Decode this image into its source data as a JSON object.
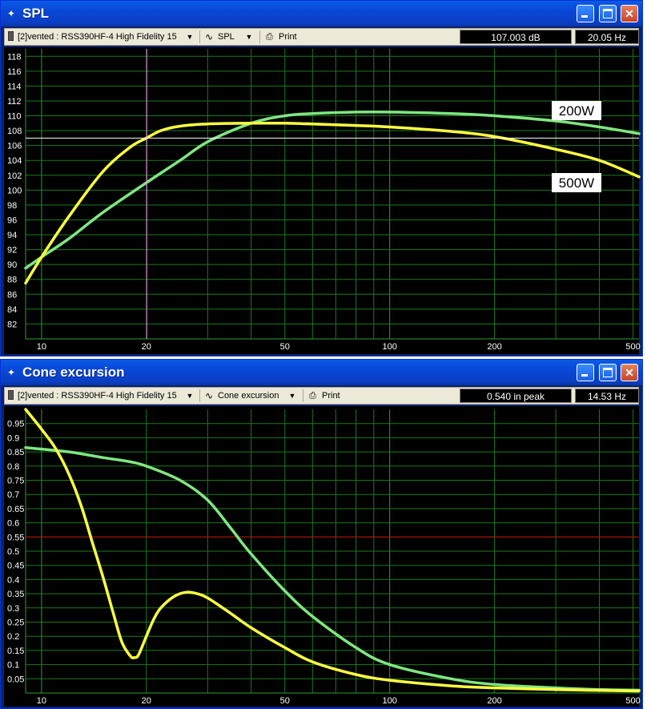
{
  "windows": [
    {
      "id": "spl",
      "title": "SPL",
      "driver_label": "[2]vented : RSS390HF-4 High Fidelity 15",
      "view_label": "SPL",
      "print_label": "Print",
      "readout_value": "107.003 dB",
      "readout_freq": "20.05 Hz"
    },
    {
      "id": "cone",
      "title": "Cone excursion",
      "driver_label": "[2]vented : RSS390HF-4 High Fidelity 15",
      "view_label": "Cone excursion",
      "print_label": "Print",
      "readout_value": "0.540 in peak",
      "readout_freq": "14.53 Hz"
    }
  ],
  "chart_data": [
    {
      "type": "line",
      "title": "SPL",
      "xscale": "log",
      "xlim": [
        9,
        520
      ],
      "ylim": [
        80,
        119
      ],
      "x_ticks": [
        10,
        20,
        50,
        100,
        200,
        500
      ],
      "y_ticks": [
        82,
        84,
        86,
        88,
        90,
        92,
        94,
        96,
        98,
        100,
        102,
        104,
        106,
        108,
        110,
        112,
        114,
        116,
        118
      ],
      "grid": true,
      "cursor": {
        "x": 20.05,
        "y": 107.003,
        "x_color": "#ff80ff",
        "y_color": "#ffffff"
      },
      "annotations": [
        "200W",
        "500W"
      ],
      "series": [
        {
          "color": "#80e680",
          "x": [
            9,
            10,
            12,
            15,
            20,
            25,
            30,
            40,
            50,
            60,
            80,
            100,
            150,
            200,
            300,
            400,
            520
          ],
          "y": [
            89.5,
            91,
            93.5,
            97,
            101,
            104,
            106.5,
            109,
            110,
            110.3,
            110.5,
            110.5,
            110.3,
            110,
            109.3,
            108.5,
            107.6
          ]
        },
        {
          "color": "#ffff40",
          "x": [
            9,
            10,
            12,
            15,
            18,
            20,
            22,
            25,
            30,
            40,
            50,
            60,
            80,
            100,
            150,
            200,
            300,
            400,
            520
          ],
          "y": [
            87.5,
            91,
            96.5,
            102.5,
            105.8,
            107,
            108,
            108.6,
            108.9,
            109,
            109,
            108.9,
            108.7,
            108.5,
            107.9,
            107.2,
            105.5,
            104,
            101.8
          ]
        }
      ]
    },
    {
      "type": "line",
      "title": "Cone excursion",
      "xscale": "log",
      "xlim": [
        9,
        520
      ],
      "ylim": [
        0,
        1.0
      ],
      "x_ticks": [
        10,
        20,
        50,
        100,
        200,
        500
      ],
      "y_ticks": [
        0.05,
        0.1,
        0.15,
        0.2,
        0.25,
        0.3,
        0.35,
        0.4,
        0.45,
        0.5,
        0.55,
        0.6,
        0.65,
        0.7,
        0.75,
        0.8,
        0.85,
        0.9,
        0.95
      ],
      "grid": true,
      "limit_line": {
        "y": 0.55,
        "color": "#c00000"
      },
      "series": [
        {
          "color": "#80e680",
          "x": [
            9,
            12,
            15,
            18,
            20,
            25,
            30,
            35,
            40,
            50,
            60,
            80,
            100,
            150,
            200,
            300,
            400,
            520
          ],
          "y": [
            0.865,
            0.85,
            0.83,
            0.815,
            0.8,
            0.75,
            0.68,
            0.58,
            0.49,
            0.36,
            0.27,
            0.16,
            0.1,
            0.05,
            0.03,
            0.018,
            0.012,
            0.01
          ]
        },
        {
          "color": "#ffff40",
          "x": [
            9,
            10,
            11,
            12,
            13,
            14,
            15,
            16,
            17,
            18,
            18.5,
            19,
            20,
            21,
            22,
            24,
            26,
            28,
            30,
            35,
            40,
            50,
            60,
            80,
            100,
            150,
            200,
            300,
            400,
            520
          ],
          "y": [
            1.0,
            0.93,
            0.86,
            0.77,
            0.66,
            0.53,
            0.41,
            0.29,
            0.18,
            0.13,
            0.125,
            0.135,
            0.2,
            0.26,
            0.3,
            0.34,
            0.355,
            0.35,
            0.335,
            0.28,
            0.23,
            0.16,
            0.11,
            0.065,
            0.045,
            0.025,
            0.018,
            0.012,
            0.009,
            0.007
          ]
        }
      ]
    }
  ]
}
